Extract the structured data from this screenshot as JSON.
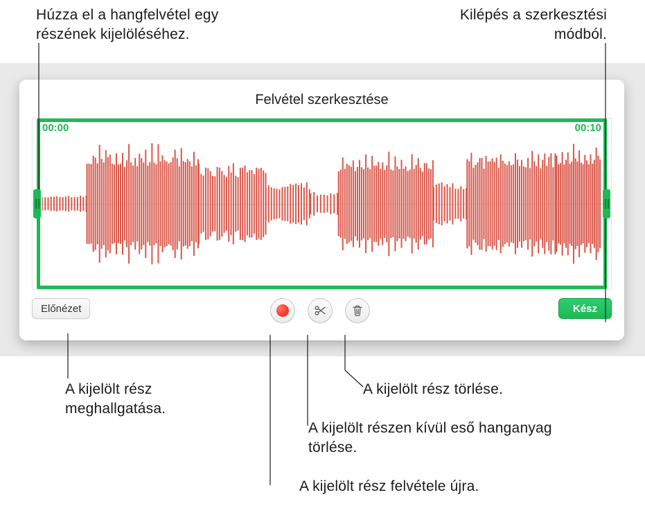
{
  "callouts": {
    "drag_select": "Húzza el a hangfelvétel egy részének kijelöléséhez.",
    "exit_mode": "Kilépés a szerkesztési módból.",
    "listen_selection": "A kijelölt rész meghallgatása.",
    "delete_selection": "A kijelölt rész törlése.",
    "trim_outside": "A kijelölt részen kívül eső hanganyag törlése.",
    "rerecord_selection": "A kijelölt rész felvétele újra."
  },
  "editor": {
    "title": "Felvétel szerkesztése",
    "time_start": "00:00",
    "time_end": "00:10"
  },
  "toolbar": {
    "preview_label": "Előnézet",
    "done_label": "Kész"
  },
  "colors": {
    "accent": "#1db954",
    "waveform": "#d9574a"
  }
}
